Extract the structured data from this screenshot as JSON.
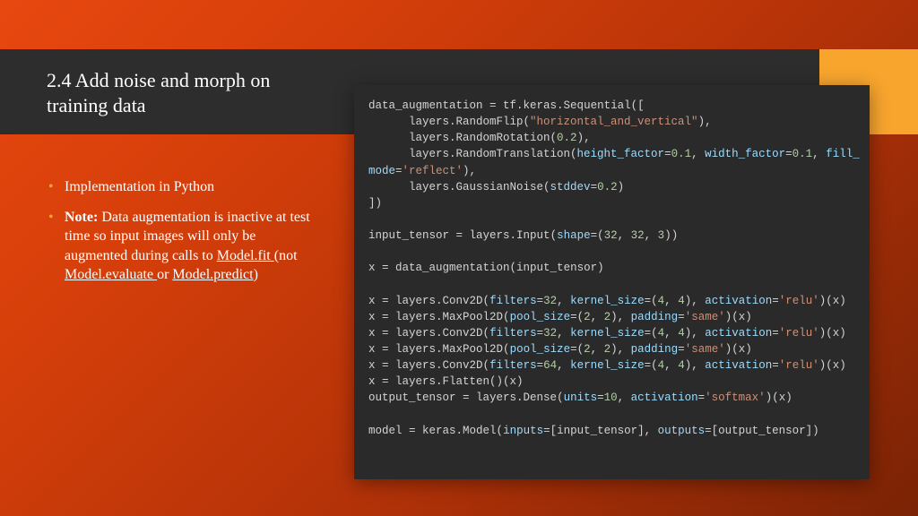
{
  "title": "2.4 Add noise and morph on training data",
  "bullets": {
    "b1": "Implementation in Python",
    "b2_prefix": "Note:",
    "b2_mid1": " Data augmentation is inactive at test time so input images will only be augmented during calls to ",
    "b2_link1": "Model.fit ",
    "b2_mid2": "(not ",
    "b2_link2": "Model.evaluate ",
    "b2_mid3": "or ",
    "b2_link3": "Model.predict",
    "b2_end": ")"
  },
  "code": {
    "l01a": "data_augmentation ",
    "l01b": "=",
    "l01c": " tf.keras.Sequential([",
    "l02a": "      layers.RandomFlip(",
    "l02b": "\"horizontal_and_vertical\"",
    "l02c": "),",
    "l03a": "      layers.RandomRotation(",
    "l03b": "0.2",
    "l03c": "),",
    "l04a": "      layers.RandomTranslation(",
    "l04b": "height_factor",
    "l04c": "=",
    "l04d": "0.1",
    "l04e": ", ",
    "l04f": "width_factor",
    "l04g": "=",
    "l04h": "0.1",
    "l04i": ", ",
    "l04j": "fill_",
    "l05a": "mode",
    "l05b": "=",
    "l05c": "'reflect'",
    "l05d": "),",
    "l06a": "      layers.GaussianNoise(",
    "l06b": "stddev",
    "l06c": "=",
    "l06d": "0.2",
    "l06e": ")",
    "l07": "])",
    "l08": "",
    "l09a": "input_tensor ",
    "l09b": "=",
    "l09c": " layers.Input(",
    "l09d": "shape",
    "l09e": "=(",
    "l09f": "32",
    "l09g": ", ",
    "l09h": "32",
    "l09i": ", ",
    "l09j": "3",
    "l09k": "))",
    "l10": "",
    "l11a": "x ",
    "l11b": "=",
    "l11c": " data_augmentation(input_tensor)",
    "l12": "",
    "l13a": "x ",
    "l13b": "=",
    "l13c": " layers.Conv2D(",
    "l13d": "filters",
    "l13e": "=",
    "l13f": "32",
    "l13g": ", ",
    "l13h": "kernel_size",
    "l13i": "=(",
    "l13j": "4",
    "l13k": ", ",
    "l13l": "4",
    "l13m": "), ",
    "l13n": "activation",
    "l13o": "=",
    "l13p": "'relu'",
    "l13q": ")(x)",
    "l14a": "x ",
    "l14b": "=",
    "l14c": " layers.MaxPool2D(",
    "l14d": "pool_size",
    "l14e": "=(",
    "l14f": "2",
    "l14g": ", ",
    "l14h": "2",
    "l14i": "), ",
    "l14j": "padding",
    "l14k": "=",
    "l14l": "'same'",
    "l14m": ")(x)",
    "l15a": "x ",
    "l15b": "=",
    "l15c": " layers.Conv2D(",
    "l15d": "filters",
    "l15e": "=",
    "l15f": "32",
    "l15g": ", ",
    "l15h": "kernel_size",
    "l15i": "=(",
    "l15j": "4",
    "l15k": ", ",
    "l15l": "4",
    "l15m": "), ",
    "l15n": "activation",
    "l15o": "=",
    "l15p": "'relu'",
    "l15q": ")(x)",
    "l16a": "x ",
    "l16b": "=",
    "l16c": " layers.MaxPool2D(",
    "l16d": "pool_size",
    "l16e": "=(",
    "l16f": "2",
    "l16g": ", ",
    "l16h": "2",
    "l16i": "), ",
    "l16j": "padding",
    "l16k": "=",
    "l16l": "'same'",
    "l16m": ")(x)",
    "l17a": "x ",
    "l17b": "=",
    "l17c": " layers.Conv2D(",
    "l17d": "filters",
    "l17e": "=",
    "l17f": "64",
    "l17g": ", ",
    "l17h": "kernel_size",
    "l17i": "=(",
    "l17j": "4",
    "l17k": ", ",
    "l17l": "4",
    "l17m": "), ",
    "l17n": "activation",
    "l17o": "=",
    "l17p": "'relu'",
    "l17q": ")(x)",
    "l18a": "x ",
    "l18b": "=",
    "l18c": " layers.Flatten()(x)",
    "l19a": "output_tensor ",
    "l19b": "=",
    "l19c": " layers.Dense(",
    "l19d": "units",
    "l19e": "=",
    "l19f": "10",
    "l19g": ", ",
    "l19h": "activation",
    "l19i": "=",
    "l19j": "'softmax'",
    "l19k": ")(x)",
    "l20": "",
    "l21a": "model ",
    "l21b": "=",
    "l21c": " keras.Model(",
    "l21d": "inputs",
    "l21e": "=[input_tensor], ",
    "l21f": "outputs",
    "l21g": "=[output_tensor])"
  }
}
